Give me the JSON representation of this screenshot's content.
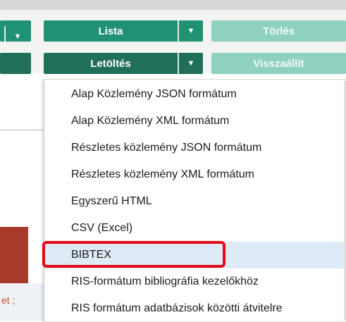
{
  "toolbar": {
    "lista": "Lista",
    "letoltes": "Letöltés",
    "torles": "Törlés",
    "visszaallit": "Visszaállít",
    "caret": "▼"
  },
  "menu": {
    "items": [
      "Alap Közlemény JSON formátum",
      "Alap Közlemény XML formátum",
      "Részletes közlemény JSON formátum",
      "Részletes közlemény XML formátum",
      "Egyszerű HTML",
      "CSV (Excel)",
      "BIBTEX",
      "RIS-formátum bibliográfia kezelőkhöz",
      "RIS formátum adatbázisok közötti átvitelre"
    ],
    "selected": "BIBTEX"
  },
  "partial": {
    "left_text": "et ;"
  },
  "colors": {
    "button_green": "#219173",
    "button_dark": "#1f6f5b",
    "button_light": "#8ed1bf",
    "highlight_red": "#e20a16",
    "left_panel_red": "#a93a2b"
  }
}
